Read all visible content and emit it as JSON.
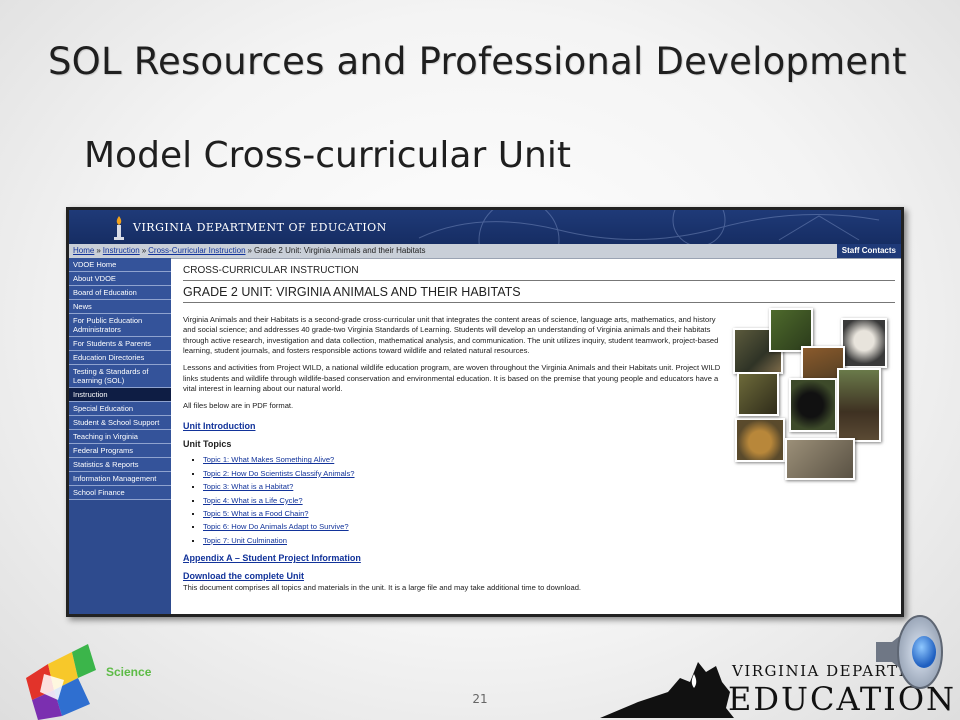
{
  "slide": {
    "title": "SOL Resources and Professional Development",
    "subtitle": "Model Cross-curricular Unit",
    "page_number": "21"
  },
  "vdoe_page": {
    "site_name": "VIRGINIA DEPARTMENT OF EDUCATION",
    "breadcrumb": [
      "Home",
      "Instruction",
      "Cross-Curricular Instruction"
    ],
    "breadcrumb_current": "Grade 2 Unit: Virginia Animals and their Habitats",
    "staff_contacts": "Staff Contacts",
    "nav": [
      "VDOE Home",
      "About VDOE",
      "Board of Education",
      "News",
      "For Public Education Administrators",
      "For Students & Parents",
      "Education Directories",
      "Testing & Standards of Learning (SOL)",
      "Instruction",
      "Special Education",
      "Student & School Support",
      "Teaching in Virginia",
      "Federal Programs",
      "Statistics & Reports",
      "Information Management",
      "School Finance"
    ],
    "section_label": "CROSS-CURRICULAR INSTRUCTION",
    "unit_title": "GRADE 2 UNIT:  VIRGINIA ANIMALS AND THEIR HABITATS",
    "para1": "Virginia Animals and their Habitats is a second-grade cross-curricular unit that integrates the content areas of science, language arts, mathematics, and history and social science; and addresses 40 grade-two Virginia Standards of Learning. Students will develop an understanding of Virginia animals and their habitats through active research, investigation and data collection, mathematical analysis, and communication. The unit utilizes inquiry, student teamwork, project-based learning, student journals, and fosters responsible actions toward wildlife and related natural resources.",
    "para2": "Lessons and activities from Project WILD, a national wildlife education program, are woven throughout the Virginia Animals and their Habitats unit. Project WILD links students and wildlife through wildlife-based conservation and environmental education. It is based on the premise that young people and educators have a vital interest in learning about our natural world.",
    "para3": "All files below are in PDF format.",
    "unit_intro": "Unit Introduction",
    "topics_heading": "Unit Topics",
    "topics": [
      "Topic 1: What Makes Something Alive?",
      "Topic 2: How Do Scientists Classify Animals?",
      "Topic 3: What is a Habitat?",
      "Topic 4: What is a Life Cycle?",
      "Topic 5: What is a Food Chain?",
      "Topic 6: How Do Animals Adapt to Survive?",
      "Topic 7: Unit Culmination"
    ],
    "appendix": "Appendix A – Student Project Information",
    "download": "Download the complete Unit",
    "download_note": "This document comprises all topics and materials in the unit. It is a large file and may take additional time to download."
  },
  "logos": {
    "science_label": "Science",
    "vdoe_line1": "VIRGINIA DEPARTM",
    "vdoe_line2": "EDUCATION"
  }
}
